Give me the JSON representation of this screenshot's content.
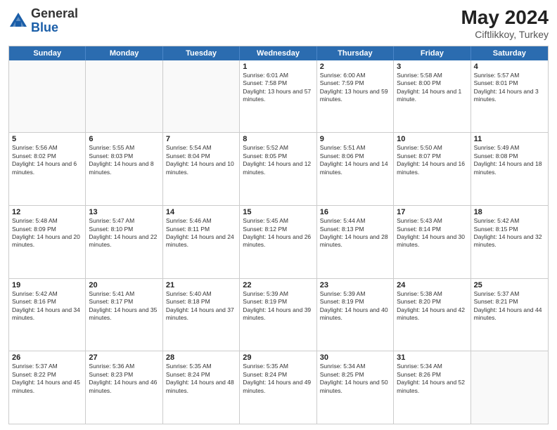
{
  "header": {
    "logo_general": "General",
    "logo_blue": "Blue",
    "month_year": "May 2024",
    "location": "Ciftlikkoy, Turkey"
  },
  "weekdays": [
    "Sunday",
    "Monday",
    "Tuesday",
    "Wednesday",
    "Thursday",
    "Friday",
    "Saturday"
  ],
  "rows": [
    [
      {
        "day": "",
        "sunrise": "",
        "sunset": "",
        "daylight": ""
      },
      {
        "day": "",
        "sunrise": "",
        "sunset": "",
        "daylight": ""
      },
      {
        "day": "",
        "sunrise": "",
        "sunset": "",
        "daylight": ""
      },
      {
        "day": "1",
        "sunrise": "Sunrise: 6:01 AM",
        "sunset": "Sunset: 7:58 PM",
        "daylight": "Daylight: 13 hours and 57 minutes."
      },
      {
        "day": "2",
        "sunrise": "Sunrise: 6:00 AM",
        "sunset": "Sunset: 7:59 PM",
        "daylight": "Daylight: 13 hours and 59 minutes."
      },
      {
        "day": "3",
        "sunrise": "Sunrise: 5:58 AM",
        "sunset": "Sunset: 8:00 PM",
        "daylight": "Daylight: 14 hours and 1 minute."
      },
      {
        "day": "4",
        "sunrise": "Sunrise: 5:57 AM",
        "sunset": "Sunset: 8:01 PM",
        "daylight": "Daylight: 14 hours and 3 minutes."
      }
    ],
    [
      {
        "day": "5",
        "sunrise": "Sunrise: 5:56 AM",
        "sunset": "Sunset: 8:02 PM",
        "daylight": "Daylight: 14 hours and 6 minutes."
      },
      {
        "day": "6",
        "sunrise": "Sunrise: 5:55 AM",
        "sunset": "Sunset: 8:03 PM",
        "daylight": "Daylight: 14 hours and 8 minutes."
      },
      {
        "day": "7",
        "sunrise": "Sunrise: 5:54 AM",
        "sunset": "Sunset: 8:04 PM",
        "daylight": "Daylight: 14 hours and 10 minutes."
      },
      {
        "day": "8",
        "sunrise": "Sunrise: 5:52 AM",
        "sunset": "Sunset: 8:05 PM",
        "daylight": "Daylight: 14 hours and 12 minutes."
      },
      {
        "day": "9",
        "sunrise": "Sunrise: 5:51 AM",
        "sunset": "Sunset: 8:06 PM",
        "daylight": "Daylight: 14 hours and 14 minutes."
      },
      {
        "day": "10",
        "sunrise": "Sunrise: 5:50 AM",
        "sunset": "Sunset: 8:07 PM",
        "daylight": "Daylight: 14 hours and 16 minutes."
      },
      {
        "day": "11",
        "sunrise": "Sunrise: 5:49 AM",
        "sunset": "Sunset: 8:08 PM",
        "daylight": "Daylight: 14 hours and 18 minutes."
      }
    ],
    [
      {
        "day": "12",
        "sunrise": "Sunrise: 5:48 AM",
        "sunset": "Sunset: 8:09 PM",
        "daylight": "Daylight: 14 hours and 20 minutes."
      },
      {
        "day": "13",
        "sunrise": "Sunrise: 5:47 AM",
        "sunset": "Sunset: 8:10 PM",
        "daylight": "Daylight: 14 hours and 22 minutes."
      },
      {
        "day": "14",
        "sunrise": "Sunrise: 5:46 AM",
        "sunset": "Sunset: 8:11 PM",
        "daylight": "Daylight: 14 hours and 24 minutes."
      },
      {
        "day": "15",
        "sunrise": "Sunrise: 5:45 AM",
        "sunset": "Sunset: 8:12 PM",
        "daylight": "Daylight: 14 hours and 26 minutes."
      },
      {
        "day": "16",
        "sunrise": "Sunrise: 5:44 AM",
        "sunset": "Sunset: 8:13 PM",
        "daylight": "Daylight: 14 hours and 28 minutes."
      },
      {
        "day": "17",
        "sunrise": "Sunrise: 5:43 AM",
        "sunset": "Sunset: 8:14 PM",
        "daylight": "Daylight: 14 hours and 30 minutes."
      },
      {
        "day": "18",
        "sunrise": "Sunrise: 5:42 AM",
        "sunset": "Sunset: 8:15 PM",
        "daylight": "Daylight: 14 hours and 32 minutes."
      }
    ],
    [
      {
        "day": "19",
        "sunrise": "Sunrise: 5:42 AM",
        "sunset": "Sunset: 8:16 PM",
        "daylight": "Daylight: 14 hours and 34 minutes."
      },
      {
        "day": "20",
        "sunrise": "Sunrise: 5:41 AM",
        "sunset": "Sunset: 8:17 PM",
        "daylight": "Daylight: 14 hours and 35 minutes."
      },
      {
        "day": "21",
        "sunrise": "Sunrise: 5:40 AM",
        "sunset": "Sunset: 8:18 PM",
        "daylight": "Daylight: 14 hours and 37 minutes."
      },
      {
        "day": "22",
        "sunrise": "Sunrise: 5:39 AM",
        "sunset": "Sunset: 8:19 PM",
        "daylight": "Daylight: 14 hours and 39 minutes."
      },
      {
        "day": "23",
        "sunrise": "Sunrise: 5:39 AM",
        "sunset": "Sunset: 8:19 PM",
        "daylight": "Daylight: 14 hours and 40 minutes."
      },
      {
        "day": "24",
        "sunrise": "Sunrise: 5:38 AM",
        "sunset": "Sunset: 8:20 PM",
        "daylight": "Daylight: 14 hours and 42 minutes."
      },
      {
        "day": "25",
        "sunrise": "Sunrise: 5:37 AM",
        "sunset": "Sunset: 8:21 PM",
        "daylight": "Daylight: 14 hours and 44 minutes."
      }
    ],
    [
      {
        "day": "26",
        "sunrise": "Sunrise: 5:37 AM",
        "sunset": "Sunset: 8:22 PM",
        "daylight": "Daylight: 14 hours and 45 minutes."
      },
      {
        "day": "27",
        "sunrise": "Sunrise: 5:36 AM",
        "sunset": "Sunset: 8:23 PM",
        "daylight": "Daylight: 14 hours and 46 minutes."
      },
      {
        "day": "28",
        "sunrise": "Sunrise: 5:35 AM",
        "sunset": "Sunset: 8:24 PM",
        "daylight": "Daylight: 14 hours and 48 minutes."
      },
      {
        "day": "29",
        "sunrise": "Sunrise: 5:35 AM",
        "sunset": "Sunset: 8:24 PM",
        "daylight": "Daylight: 14 hours and 49 minutes."
      },
      {
        "day": "30",
        "sunrise": "Sunrise: 5:34 AM",
        "sunset": "Sunset: 8:25 PM",
        "daylight": "Daylight: 14 hours and 50 minutes."
      },
      {
        "day": "31",
        "sunrise": "Sunrise: 5:34 AM",
        "sunset": "Sunset: 8:26 PM",
        "daylight": "Daylight: 14 hours and 52 minutes."
      },
      {
        "day": "",
        "sunrise": "",
        "sunset": "",
        "daylight": ""
      }
    ]
  ]
}
